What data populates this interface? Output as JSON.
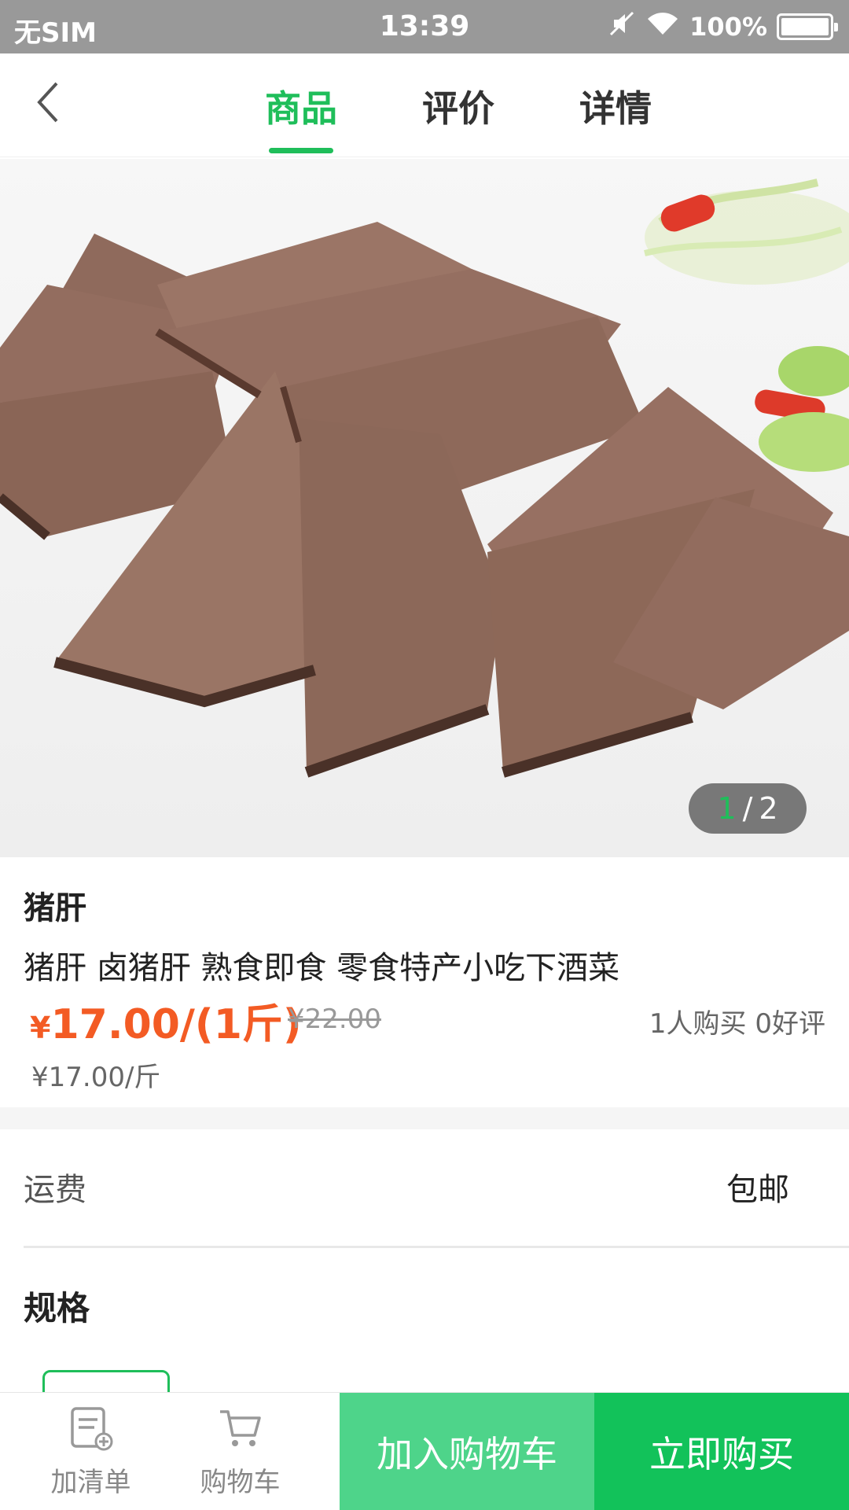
{
  "status_bar": {
    "carrier": "无SIM",
    "time": "13:39",
    "battery": "100%"
  },
  "nav": {
    "tabs": [
      {
        "label": "商品",
        "active": true
      },
      {
        "label": "评价",
        "active": false
      },
      {
        "label": "详情",
        "active": false
      }
    ]
  },
  "gallery": {
    "current": "1",
    "separator": "/",
    "total": "2"
  },
  "product": {
    "name": "猪肝",
    "description": "猪肝 卤猪肝 熟食即食 零食特产小吃下酒菜",
    "price_symbol": "¥",
    "price": "17.00/(1斤)",
    "original_price": "¥22.00",
    "sales": "1人购买 0好评",
    "unit_price": "¥17.00/斤"
  },
  "shipping": {
    "label": "运费",
    "value": "包邮"
  },
  "spec": {
    "title": "规格"
  },
  "bottom_bar": {
    "list_label": "加清单",
    "cart_label": "购物车",
    "add_to_cart": "加入购物车",
    "buy_now": "立即购买"
  },
  "colors": {
    "accent": "#1fbe5a",
    "price": "#f35b24",
    "cart_button": "#4ed48a",
    "buy_button": "#12c25a"
  }
}
